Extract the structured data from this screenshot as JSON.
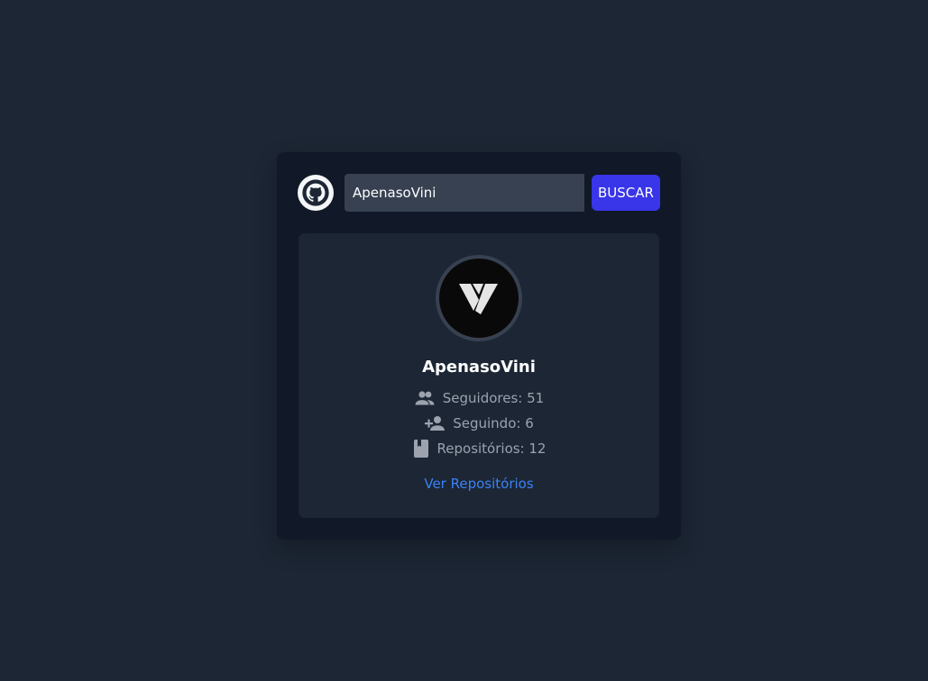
{
  "search": {
    "value": "ApenasoVini",
    "button_label": "BUSCAR"
  },
  "icons": {
    "brand": "github-icon",
    "followers": "group-icon",
    "following": "person-add-icon",
    "repos": "book-icon"
  },
  "profile": {
    "username": "ApenasoVini",
    "followers_label": "Seguidores: 51",
    "following_label": "Seguindo: 6",
    "repos_label": "Repositórios: 12",
    "repos_link": "Ver Repositórios"
  },
  "colors": {
    "background": "#1c2634",
    "card": "#111827",
    "input": "#374151",
    "button": "#3935e8",
    "link": "#3b82f6",
    "muted_text": "#9ca3af"
  }
}
